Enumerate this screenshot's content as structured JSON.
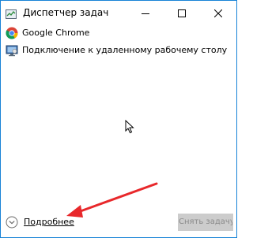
{
  "window": {
    "title": "Диспетчер задач",
    "border_color": "#1883d7"
  },
  "processes": [
    {
      "name": "Google Chrome",
      "icon": "chrome-icon"
    },
    {
      "name": "Подключение к удаленному рабочему столу",
      "icon": "remote-desktop-icon"
    }
  ],
  "footer": {
    "details_label": "Подробнее",
    "end_task_label": "Снять задачу",
    "end_task_disabled": true
  },
  "annotation": {
    "arrow_color": "#e8282b"
  }
}
